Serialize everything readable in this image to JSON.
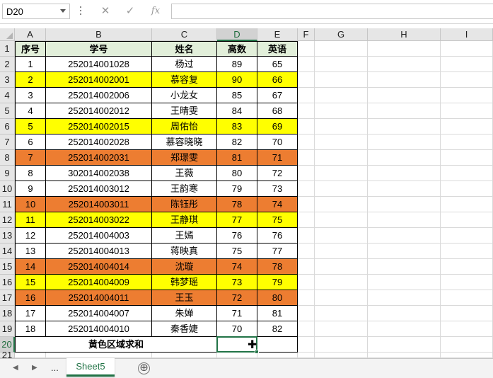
{
  "name_box": "D20",
  "formula_icons": {
    "cancel": "✕",
    "enter": "✓",
    "function": "fx"
  },
  "formula": "",
  "columns": [
    "A",
    "B",
    "C",
    "D",
    "E",
    "F",
    "G",
    "H",
    "I"
  ],
  "selected_column": "D",
  "selected_row": 20,
  "table_header": [
    "序号",
    "学号",
    "姓名",
    "高数",
    "英语"
  ],
  "rows": [
    {
      "no": "1",
      "id": "252014001028",
      "name": "杨过",
      "math": "89",
      "eng": "65",
      "fill": "none"
    },
    {
      "no": "2",
      "id": "252014002001",
      "name": "慕容复",
      "math": "90",
      "eng": "66",
      "fill": "yellow"
    },
    {
      "no": "3",
      "id": "252014002006",
      "name": "小龙女",
      "math": "85",
      "eng": "67",
      "fill": "none"
    },
    {
      "no": "4",
      "id": "252014002012",
      "name": "王晴雯",
      "math": "84",
      "eng": "68",
      "fill": "none"
    },
    {
      "no": "5",
      "id": "252014002015",
      "name": "周佑怡",
      "math": "83",
      "eng": "69",
      "fill": "yellow"
    },
    {
      "no": "6",
      "id": "252014002028",
      "name": "慕容晓晓",
      "math": "82",
      "eng": "70",
      "fill": "none"
    },
    {
      "no": "7",
      "id": "252014002031",
      "name": "郑璟雯",
      "math": "81",
      "eng": "71",
      "fill": "orange"
    },
    {
      "no": "8",
      "id": "302014002038",
      "name": "王薇",
      "math": "80",
      "eng": "72",
      "fill": "none"
    },
    {
      "no": "9",
      "id": "252014003012",
      "name": "王韵寒",
      "math": "79",
      "eng": "73",
      "fill": "none"
    },
    {
      "no": "10",
      "id": "252014003011",
      "name": "陈钰彤",
      "math": "78",
      "eng": "74",
      "fill": "orange"
    },
    {
      "no": "11",
      "id": "252014003022",
      "name": "王静琪",
      "math": "77",
      "eng": "75",
      "fill": "yellow"
    },
    {
      "no": "12",
      "id": "252014004003",
      "name": "王嫣",
      "math": "76",
      "eng": "76",
      "fill": "none"
    },
    {
      "no": "13",
      "id": "252014004013",
      "name": "蒋映真",
      "math": "75",
      "eng": "77",
      "fill": "none"
    },
    {
      "no": "14",
      "id": "252014004014",
      "name": "沈璇",
      "math": "74",
      "eng": "78",
      "fill": "orange"
    },
    {
      "no": "15",
      "id": "252014004009",
      "name": "韩梦瑶",
      "math": "73",
      "eng": "79",
      "fill": "yellow"
    },
    {
      "no": "16",
      "id": "252014004011",
      "name": "王玉",
      "math": "72",
      "eng": "80",
      "fill": "orange"
    },
    {
      "no": "17",
      "id": "252014004007",
      "name": "朱婵",
      "math": "71",
      "eng": "81",
      "fill": "none"
    },
    {
      "no": "18",
      "id": "252014004010",
      "name": "秦香婕",
      "math": "70",
      "eng": "82",
      "fill": "none"
    }
  ],
  "summary_label": "黄色区域求和",
  "colors": {
    "yellow": "#ffff00",
    "orange": "#ed7d31",
    "header_fill": "#e2efda",
    "accent": "#217346"
  },
  "sheet_tabs": [
    "Sheet5"
  ],
  "tab_overflow": "...",
  "add_sheet_icon": "⊕"
}
